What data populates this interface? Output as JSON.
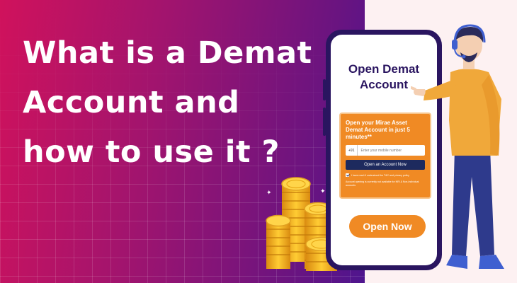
{
  "headline": {
    "line1": "What is a Demat",
    "line2": "Account and",
    "line3": "how to use it ?"
  },
  "phone": {
    "title_line1": "Open Demat",
    "title_line2": "Account",
    "form": {
      "heading": "Open your Mirae Asset Demat Account in just 5 minutes**",
      "country_code": "+91",
      "mobile_placeholder": "Enter your mobile number",
      "submit_label": "Open an Account Now",
      "consent_text": "I have read & understood the T&C and privacy policy",
      "note": "Account opening is currently not available for NRI & Non-Individual accounts"
    },
    "cta_label": "Open Now"
  },
  "colors": {
    "gradient_start": "#d0125c",
    "gradient_end": "#4a1590",
    "panel": "#fdf1f2",
    "accent_orange": "#f08a24",
    "phone_frame": "#2a1560",
    "button_navy": "#1d2a5e"
  },
  "icons": {
    "coins": "gold-coin-stack-icon",
    "character": "support-agent-pointing-illustration",
    "sparkle": "sparkle-icon"
  }
}
